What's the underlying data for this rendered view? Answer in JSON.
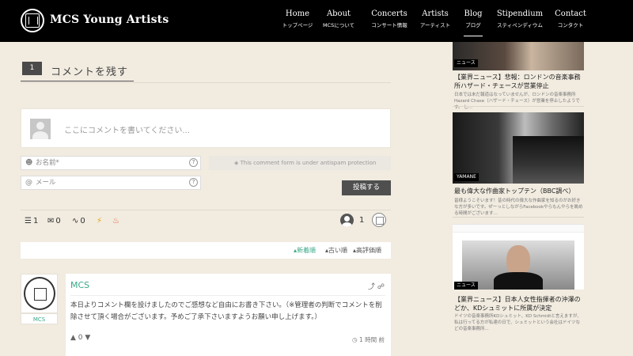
{
  "header": {
    "brand": "MCS Young Artists",
    "nav": [
      {
        "en": "Home",
        "ja": "トップページ"
      },
      {
        "en": "About",
        "ja": "MCSについて"
      },
      {
        "en": "Concerts",
        "ja": "コンサート情報"
      },
      {
        "en": "Artists",
        "ja": "アーティスト"
      },
      {
        "en": "Blog",
        "ja": "ブログ"
      },
      {
        "en": "Stipendium",
        "ja": "スティペンディウム"
      },
      {
        "en": "Contact",
        "ja": "コンタクト"
      }
    ]
  },
  "comments": {
    "section_number": "1",
    "section_title": "コメントを残す",
    "editor_placeholder": "ここにコメントを書いてください...",
    "name_placeholder": "お名前*",
    "email_placeholder": "メール",
    "antispam": "This comment form is under antispam protection",
    "submit_label": "投稿する",
    "stats": {
      "threads": "1",
      "replies": "0",
      "followers": "0",
      "users": "1"
    },
    "sort": [
      "新着順",
      "古い順",
      "高評価順"
    ],
    "items": [
      {
        "author": "MCS",
        "author_tag": "MCS",
        "text": "本日よりコメント欄を設けましたのでご感想など自由にお書き下さい。（※管理者の判断でコメントを削除させて頂く場合がございます。予めご了承下さいますようお願い申し上げます。）",
        "votes": "0",
        "time": "1 時間 前"
      }
    ]
  },
  "sidebar": {
    "posts": [
      {
        "tag": "ニュース",
        "title": "【業界ニュース】悲報：ロンドンの音楽事務所ハザード・チェースが営業停止",
        "desc": "日本では未だ報道はなっていませんが、ロンドンの音楽事務所Hazard Chase（ハザード・チェース）が営業を停止したようです。 し..."
      },
      {
        "tag": "YAMANE",
        "title": "最も偉大な作曲家トップテン（BBC調べ）",
        "desc": "皆様ようこそいます！昔の時代の偉大な作曲家を知るのがお好きな方が多いです。ぜーっとしながらFacebookやらもんやらを眺める時間がございます…"
      },
      {
        "tag": "ニュース",
        "title": "【業界ニュース】日本人女性指揮者の沖澤のどか、KDシュミットに所属が決定",
        "desc": "ドイツの音楽事務所KDシュミット、KD Schmidtと言えますが、私は行ってる方が私達の日で、シュミットという会社はドイツなどの音楽事務所..."
      }
    ]
  }
}
